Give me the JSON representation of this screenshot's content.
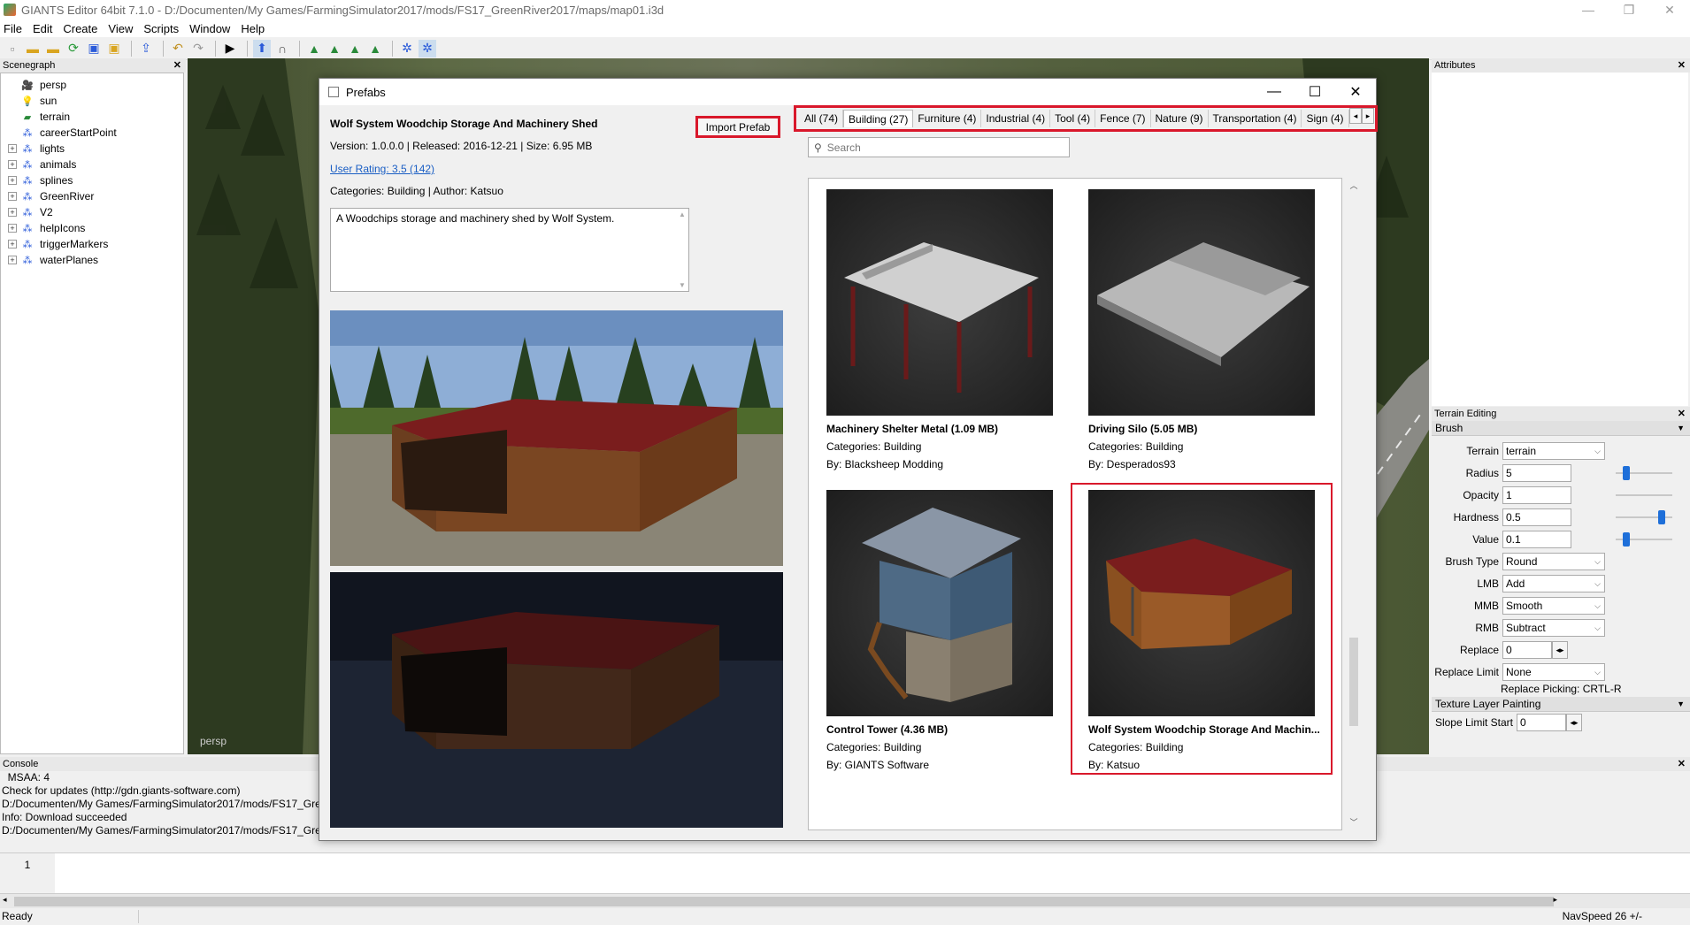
{
  "window": {
    "title": "GIANTS Editor 64bit 7.1.0 - D:/Documenten/My Games/FarmingSimulator2017/mods/FS17_GreenRiver2017/maps/map01.i3d",
    "minimize": "—",
    "restore": "❐",
    "close": "✕"
  },
  "menu": [
    "File",
    "Edit",
    "Create",
    "View",
    "Scripts",
    "Window",
    "Help"
  ],
  "scenegraph": {
    "title": "Scenegraph",
    "items": [
      {
        "label": "persp",
        "icon": "camera-icon",
        "expandable": false
      },
      {
        "label": "sun",
        "icon": "light-bulb-icon",
        "expandable": false
      },
      {
        "label": "terrain",
        "icon": "terrain-icon",
        "expandable": false
      },
      {
        "label": "careerStartPoint",
        "icon": "transform-group-icon",
        "expandable": false
      },
      {
        "label": "lights",
        "icon": "transform-group-icon",
        "expandable": true
      },
      {
        "label": "animals",
        "icon": "transform-group-icon",
        "expandable": true
      },
      {
        "label": "splines",
        "icon": "transform-group-icon",
        "expandable": true
      },
      {
        "label": "GreenRiver",
        "icon": "transform-group-icon",
        "expandable": true
      },
      {
        "label": "V2",
        "icon": "transform-group-icon",
        "expandable": true
      },
      {
        "label": "helpIcons",
        "icon": "transform-group-icon",
        "expandable": true
      },
      {
        "label": "triggerMarkers",
        "icon": "transform-group-icon",
        "expandable": true
      },
      {
        "label": "waterPlanes",
        "icon": "transform-group-icon",
        "expandable": true
      }
    ]
  },
  "viewport": {
    "label": "persp"
  },
  "attributes": {
    "title": "Attributes"
  },
  "terrain_editing": {
    "title": "Terrain Editing",
    "brush_section": "Brush",
    "terrain_label": "Terrain",
    "terrain_value": "terrain",
    "radius_label": "Radius",
    "radius_value": "5",
    "opacity_label": "Opacity",
    "opacity_value": "1",
    "hardness_label": "Hardness",
    "hardness_value": "0.5",
    "value_label": "Value",
    "value_value": "0.1",
    "brush_type_label": "Brush Type",
    "brush_type_value": "Round",
    "lmb_label": "LMB",
    "lmb_value": "Add",
    "mmb_label": "MMB",
    "mmb_value": "Smooth",
    "rmb_label": "RMB",
    "rmb_value": "Subtract",
    "replace_label": "Replace",
    "replace_value": "0",
    "replace_limit_label": "Replace Limit",
    "replace_limit_value": "None",
    "replace_picking": "Replace Picking: CRTL-R",
    "texture_section": "Texture Layer Painting",
    "slope_label": "Slope Limit Start",
    "slope_value": "0"
  },
  "console": {
    "title": "Console",
    "lines": [
      "  MSAA: 4",
      "Check for updates (http://gdn.giants-software.com)",
      "D:/Documenten/My Games/FarmingSimulator2017/mods/FS17_Gre",
      "Info: Download succeeded",
      "D:/Documenten/My Games/FarmingSimulator2017/mods/FS17_Gre"
    ]
  },
  "script_editor": {
    "line_number": "1"
  },
  "statusbar": {
    "left": "Ready",
    "right": "NavSpeed 26 +/-"
  },
  "prefabs": {
    "title": "Prefabs",
    "import_button": "Import Prefab",
    "detail": {
      "name": "Wolf System Woodchip Storage And Machinery Shed",
      "meta": "Version: 1.0.0.0 | Released: 2016-12-21 | Size: 6.95 MB",
      "rating": "User Rating: 3.5 (142)",
      "categories": "Categories: Building | Author: Katsuo",
      "description": "A Woodchips storage and machinery shed by Wolf System."
    },
    "tabs": [
      {
        "label": "All (74)",
        "active": false
      },
      {
        "label": "Building (27)",
        "active": true
      },
      {
        "label": "Furniture (4)",
        "active": false
      },
      {
        "label": "Industrial (4)",
        "active": false
      },
      {
        "label": "Tool (4)",
        "active": false
      },
      {
        "label": "Fence (7)",
        "active": false
      },
      {
        "label": "Nature (9)",
        "active": false
      },
      {
        "label": "Transportation (4)",
        "active": false
      },
      {
        "label": "Sign (4)",
        "active": false
      }
    ],
    "search_placeholder": "Search",
    "cards": [
      {
        "name": "Machinery Shelter Metal (1.09 MB)",
        "categories": "Categories: Building",
        "author": "By: Blacksheep Modding",
        "icon": "machinery-shelter-thumbnail",
        "selected": false
      },
      {
        "name": "Driving Silo (5.05 MB)",
        "categories": "Categories: Building",
        "author": "By: Desperados93",
        "icon": "driving-silo-thumbnail",
        "selected": false
      },
      {
        "name": "Control Tower (4.36 MB)",
        "categories": "Categories: Building",
        "author": "By: GIANTS Software",
        "icon": "control-tower-thumbnail",
        "selected": false
      },
      {
        "name": "Wolf System Woodchip Storage And Machin...",
        "categories": "Categories: Building",
        "author": "By: Katsuo",
        "icon": "woodchip-shed-thumbnail",
        "selected": true
      }
    ]
  },
  "colors": {
    "highlight_red": "#d9182b",
    "link_blue": "#1a5ec4",
    "slider_blue": "#1e6fd9"
  }
}
